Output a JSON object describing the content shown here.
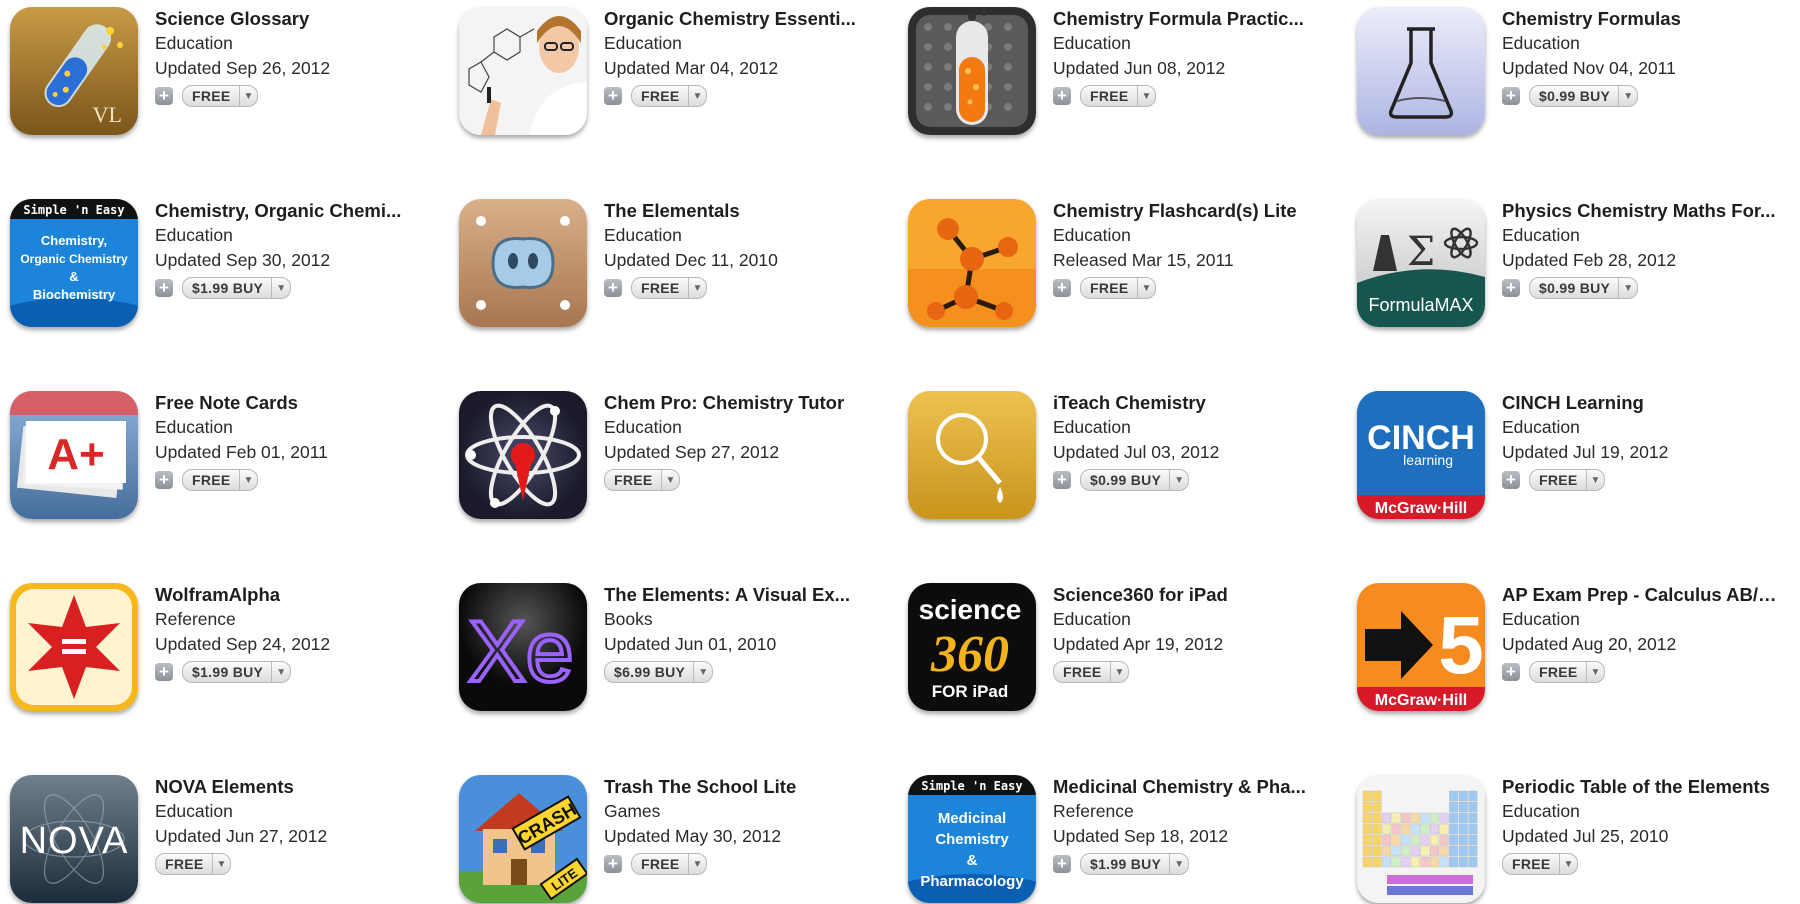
{
  "apps": [
    {
      "title": "Science Glossary",
      "category": "Education",
      "updated": "Updated Sep 26, 2012",
      "price": "FREE",
      "has_add": true,
      "icon": "test-tube-icon"
    },
    {
      "title": "Organic Chemistry Essenti...",
      "category": "Education",
      "updated": "Updated Mar 04, 2012",
      "price": "FREE",
      "has_add": true,
      "icon": "scientist-drawing-icon"
    },
    {
      "title": "Chemistry Formula Practic...",
      "category": "Education",
      "updated": "Updated Jun 08, 2012",
      "price": "FREE",
      "has_add": true,
      "icon": "orange-test-tube-icon"
    },
    {
      "title": "Chemistry Formulas",
      "category": "Education",
      "updated": "Updated Nov 04, 2011",
      "price": "$0.99  BUY",
      "has_add": true,
      "icon": "flask-icon"
    },
    {
      "title": "Chemistry, Organic Chemi...",
      "category": "Education",
      "updated": "Updated Sep 30, 2012",
      "price": "$1.99  BUY",
      "has_add": true,
      "icon": "simple-n-easy-chemistry-icon"
    },
    {
      "title": "The Elementals",
      "category": "Education",
      "updated": "Updated Dec 11, 2010",
      "price": "FREE",
      "has_add": true,
      "icon": "elemental-blob-icon"
    },
    {
      "title": "Chemistry Flashcard(s) Lite",
      "category": "Education",
      "updated": "Released Mar 15, 2011",
      "price": "FREE",
      "has_add": true,
      "icon": "molecule-icon"
    },
    {
      "title": "Physics Chemistry Maths For...",
      "category": "Education",
      "updated": "Updated Feb 28, 2012",
      "price": "$0.99  BUY",
      "has_add": true,
      "icon": "formulamax-icon"
    },
    {
      "title": "Free Note Cards",
      "category": "Education",
      "updated": "Updated Feb 01, 2011",
      "price": "FREE",
      "has_add": true,
      "icon": "note-cards-icon"
    },
    {
      "title": "Chem Pro: Chemistry Tutor",
      "category": "Education",
      "updated": "Updated Sep 27, 2012",
      "price": "FREE",
      "has_add": false,
      "icon": "atom-icon"
    },
    {
      "title": "iTeach Chemistry",
      "category": "Education",
      "updated": "Updated Jul 03, 2012",
      "price": "$0.99  BUY",
      "has_add": true,
      "icon": "retort-flask-icon"
    },
    {
      "title": "CINCH Learning",
      "category": "Education",
      "updated": "Updated Jul 19, 2012",
      "price": "FREE",
      "has_add": true,
      "icon": "cinch-learning-icon"
    },
    {
      "title": "WolframAlpha",
      "category": "Reference",
      "updated": "Updated Sep 24, 2012",
      "price": "$1.99  BUY",
      "has_add": true,
      "icon": "wolfram-star-icon"
    },
    {
      "title": "The Elements: A Visual Ex...",
      "category": "Books",
      "updated": "Updated Jun 01, 2010",
      "price": "$6.99  BUY",
      "has_add": false,
      "icon": "xenon-icon"
    },
    {
      "title": "Science360 for iPad",
      "category": "Education",
      "updated": "Updated Apr 19, 2012",
      "price": "FREE",
      "has_add": false,
      "icon": "science360-icon"
    },
    {
      "title": "AP Exam Prep - Calculus AB/B...",
      "category": "Education",
      "updated": "Updated Aug 20, 2012",
      "price": "FREE",
      "has_add": true,
      "icon": "ap-exam-5-icon"
    },
    {
      "title": "NOVA Elements",
      "category": "Education",
      "updated": "Updated Jun 27, 2012",
      "price": "FREE",
      "has_add": false,
      "icon": "nova-icon"
    },
    {
      "title": "Trash The School Lite",
      "category": "Games",
      "updated": "Updated May 30, 2012",
      "price": "FREE",
      "has_add": true,
      "icon": "crash-house-icon"
    },
    {
      "title": "Medicinal Chemistry & Pha...",
      "category": "Reference",
      "updated": "Updated Sep 18, 2012",
      "price": "$1.99  BUY",
      "has_add": true,
      "icon": "simple-n-easy-medicinal-icon"
    },
    {
      "title": "Periodic Table of the Elements",
      "category": "Education",
      "updated": "Updated Jul 25, 2010",
      "price": "FREE",
      "has_add": false,
      "icon": "periodic-table-icon"
    }
  ],
  "icon_text": {
    "vl": "VL",
    "sne_header": "Simple 'n Easy",
    "sne_chem_line1": "Chemistry,",
    "sne_chem_line2": "Organic Chemistry",
    "sne_chem_line3": "&",
    "sne_chem_line4": "Biochemistry",
    "formulamax": "FormulaMAX",
    "aplus": "A+",
    "cinch": "CINCH",
    "learning": "learning",
    "mcgraw": "McGraw·Hill",
    "xe": "Xe",
    "sci_word": "science",
    "sci_num": "360",
    "sci_ipad": "FOR iPad",
    "five": "5",
    "nova": "NOVA",
    "crash": "CRASH",
    "lite": "LITE",
    "med_line1": "Medicinal",
    "med_line2": "Chemistry",
    "med_line3": "&",
    "med_line4": "Pharmacology"
  },
  "colors": {
    "text": "#1e1e1e",
    "button_border": "#b9b9b9",
    "plus_button": "#9aa0a8"
  }
}
